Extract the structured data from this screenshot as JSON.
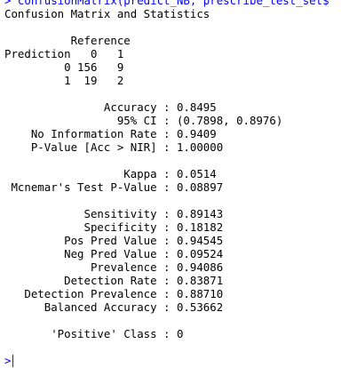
{
  "console": {
    "command_line": "> confusionMatrix(predict_NB, prescribe_test_set$",
    "title": "Confusion Matrix and Statistics",
    "matrix": {
      "header_reference": "          Reference",
      "header_prediction": "Prediction   0   1",
      "row0": "         0 156   9",
      "row1": "         1  19   2"
    },
    "overall": {
      "accuracy": "               Accuracy : 0.8495",
      "ci": "                 95% CI : (0.7898, 0.8976)",
      "nir": "    No Information Rate : 0.9409",
      "pvalue": "    P-Value [Acc > NIR] : 1.00000"
    },
    "agreement": {
      "kappa": "                  Kappa : 0.0514",
      "mcnemar": " Mcnemar's Test P-Value : 0.08897"
    },
    "class_stats": {
      "sensitivity": "            Sensitivity : 0.89143",
      "specificity": "            Specificity : 0.18182",
      "ppv": "         Pos Pred Value : 0.94545",
      "npv": "         Neg Pred Value : 0.09524",
      "prevalence": "             Prevalence : 0.94086",
      "detection_rate": "         Detection Rate : 0.83871",
      "detection_prevalence": "   Detection Prevalence : 0.88710",
      "balanced_accuracy": "      Balanced Accuracy : 0.53662"
    },
    "positive_class": "       'Positive' Class : 0",
    "prompt": ">"
  },
  "colors": {
    "command": "#0000ff",
    "output": "#000000",
    "background": "#ffffff"
  }
}
